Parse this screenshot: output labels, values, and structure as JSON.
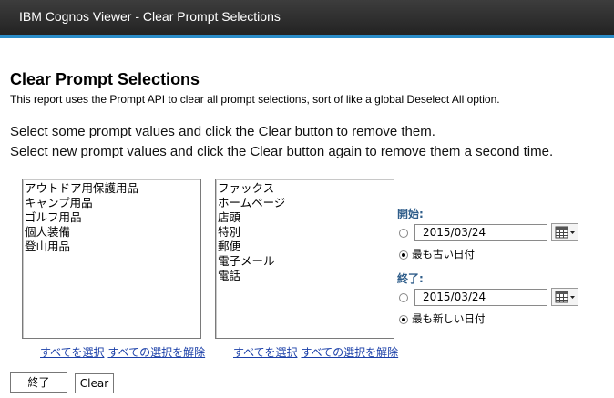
{
  "window": {
    "title": "IBM Cognos Viewer - Clear Prompt Selections"
  },
  "report": {
    "title": "Clear Prompt Selections",
    "description": "This report uses the Prompt API to clear all prompt selections, sort of like a global Deselect All option.",
    "instruction_1": "Select some prompt values and click the Clear button to remove them.",
    "instruction_2": "Select new prompt values and click the Clear button again to remove them a second time."
  },
  "list1": {
    "items": [
      "アウトドア用保護用品",
      "キャンプ用品",
      "ゴルフ用品",
      "個人装備",
      "登山用品"
    ],
    "select_all": "すべてを選択",
    "deselect_all": "すべての選択を解除"
  },
  "list2": {
    "items": [
      "ファックス",
      "ホームページ",
      "店頭",
      "特別",
      "郵便",
      "電子メール",
      "電話"
    ],
    "select_all": "すべてを選択",
    "deselect_all": "すべての選択を解除"
  },
  "date_prompt": {
    "start_label": "開始:",
    "start_value": "2015/03/24",
    "start_oldest": "最も古い日付",
    "end_label": "終了:",
    "end_value": "2015/03/24",
    "end_newest": "最も新しい日付"
  },
  "buttons": {
    "finish": "終了",
    "clear": "Clear"
  }
}
